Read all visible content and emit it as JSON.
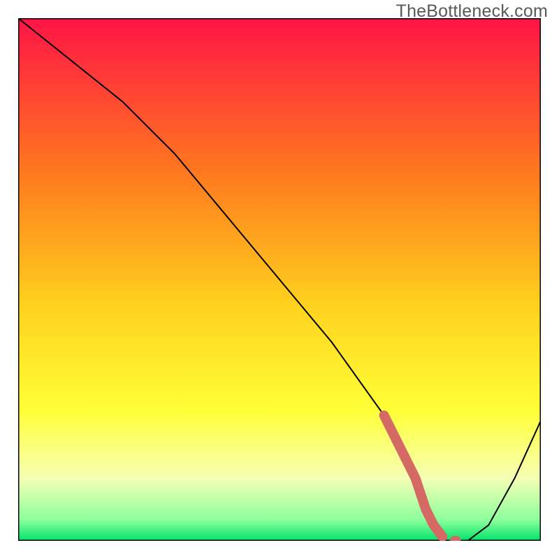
{
  "watermark": "TheBottleneck.com",
  "chart_data": {
    "type": "line",
    "title": "",
    "xlabel": "",
    "ylabel": "",
    "x_range": [
      0,
      100
    ],
    "y_range": [
      0,
      100
    ],
    "series": [
      {
        "name": "curve",
        "x": [
          0,
          10,
          20,
          30,
          40,
          50,
          60,
          70,
          75,
          78,
          80,
          82,
          84,
          86,
          90,
          95,
          100
        ],
        "y": [
          100,
          92,
          84,
          74,
          62,
          50,
          38,
          24,
          14,
          6,
          2,
          0,
          0,
          0,
          3,
          12,
          23
        ]
      }
    ],
    "highlight_segment": {
      "name": "highlight",
      "x": [
        70,
        72,
        74,
        76,
        78,
        79.5,
        81,
        82,
        84,
        86
      ],
      "y": [
        24,
        20,
        16,
        12,
        6,
        3,
        1,
        0,
        0,
        0
      ]
    },
    "background_gradient_stops": [
      {
        "offset": 0.0,
        "color": "#ff1446"
      },
      {
        "offset": 0.3,
        "color": "#ff7a1e"
      },
      {
        "offset": 0.55,
        "color": "#ffd21e"
      },
      {
        "offset": 0.75,
        "color": "#ffff36"
      },
      {
        "offset": 0.88,
        "color": "#f6ffb4"
      },
      {
        "offset": 0.96,
        "color": "#8cff9c"
      },
      {
        "offset": 1.0,
        "color": "#00e36a"
      }
    ]
  }
}
